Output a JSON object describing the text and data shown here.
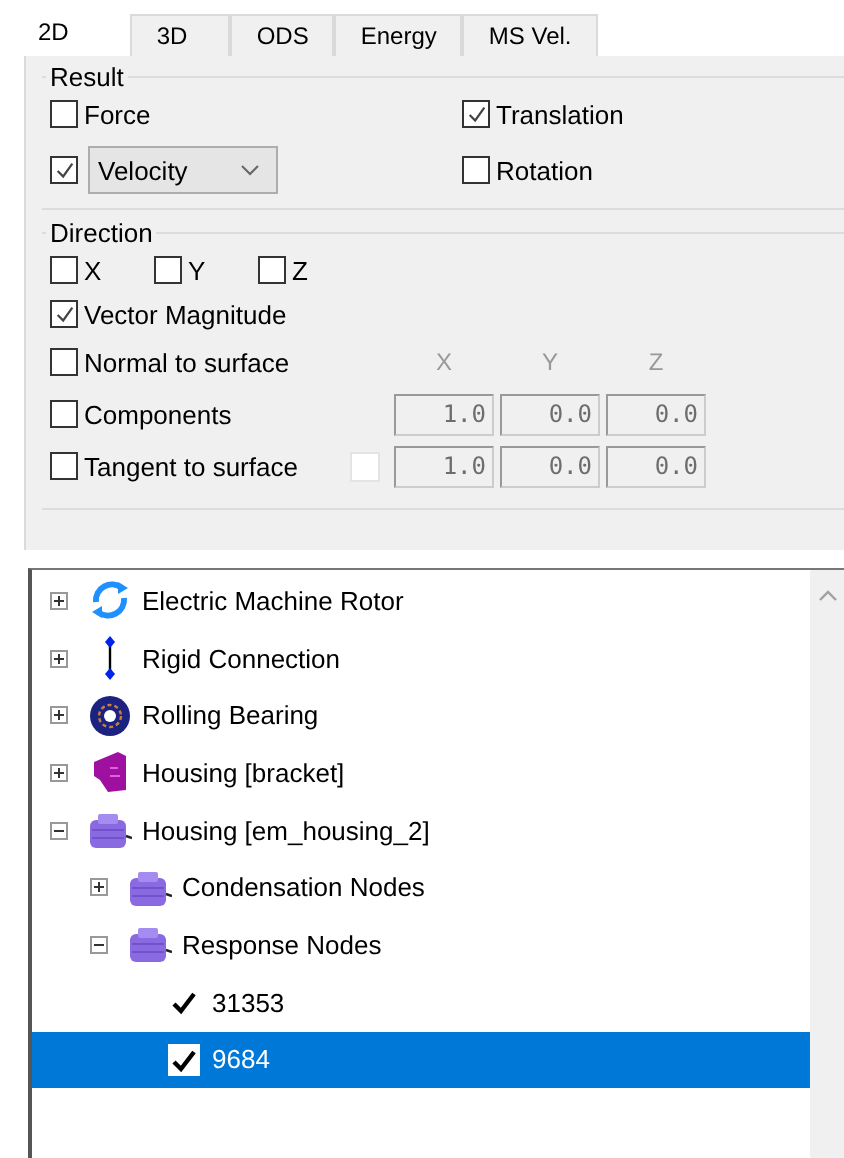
{
  "tabs": [
    {
      "label": "2D",
      "selected": true
    },
    {
      "label": "3D",
      "selected": false
    },
    {
      "label": "ODS",
      "selected": false
    },
    {
      "label": "Energy",
      "selected": false
    },
    {
      "label": "MS Vel.",
      "selected": false
    }
  ],
  "result": {
    "title": "Result",
    "force": {
      "label": "Force",
      "checked": false
    },
    "quantity": {
      "checked": true,
      "value": "Velocity"
    },
    "translation": {
      "label": "Translation",
      "checked": true
    },
    "rotation": {
      "label": "Rotation",
      "checked": false
    }
  },
  "direction": {
    "title": "Direction",
    "axes": [
      {
        "label": "X",
        "checked": false
      },
      {
        "label": "Y",
        "checked": false
      },
      {
        "label": "Z",
        "checked": false
      }
    ],
    "vector_magnitude": {
      "label": "Vector Magnitude",
      "checked": true
    },
    "normal": {
      "label": "Normal to surface",
      "checked": false
    },
    "column_headers": [
      "X",
      "Y",
      "Z"
    ],
    "components": {
      "label": "Components",
      "checked": false,
      "disabled": true,
      "values": [
        "1.0",
        "0.0",
        "0.0"
      ]
    },
    "tangent": {
      "label": "Tangent to surface",
      "checked": false,
      "option_checked": false,
      "disabled": true,
      "values": [
        "1.0",
        "0.0",
        "0.0"
      ]
    }
  },
  "tree": {
    "items": [
      {
        "label": "Electric Machine Rotor",
        "kind": "rotor",
        "expanded": false
      },
      {
        "label": "Rigid Connection",
        "kind": "link",
        "expanded": false
      },
      {
        "label": "Rolling Bearing",
        "kind": "bearing",
        "expanded": false
      },
      {
        "label": "Housing [bracket]",
        "kind": "bracket",
        "expanded": false
      },
      {
        "label": "Housing [em_housing_2]",
        "kind": "housing",
        "expanded": true,
        "children": [
          {
            "label": "Condensation Nodes",
            "kind": "housing",
            "expanded": false
          },
          {
            "label": "Response Nodes",
            "kind": "housing",
            "expanded": true,
            "children": [
              {
                "label": "31353",
                "kind": "node",
                "checked": true,
                "selected": false
              },
              {
                "label": "9684",
                "kind": "node",
                "checked": true,
                "selected": true
              }
            ]
          }
        ]
      }
    ]
  }
}
